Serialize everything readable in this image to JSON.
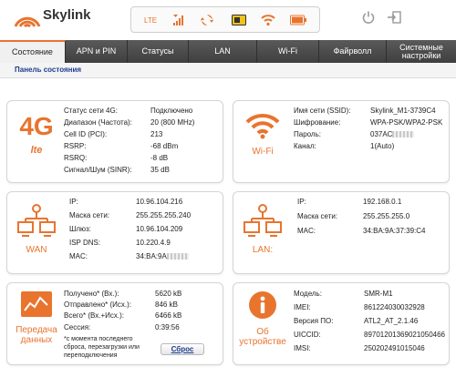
{
  "colors": {
    "accent": "#e8742e",
    "nav_bg": "#4a4a4a",
    "link": "#1d3d8f"
  },
  "header": {
    "brand": "Skylink",
    "status_icons": [
      "lte-text",
      "signal-bars-icon",
      "sync-icon",
      "sim-card-icon",
      "wifi-icon",
      "battery-icon"
    ],
    "lte_label": "LTE"
  },
  "nav": {
    "items": [
      {
        "label": "Состояние"
      },
      {
        "label": "APN и PIN"
      },
      {
        "label": "Статусы"
      },
      {
        "label": "LAN"
      },
      {
        "label": "Wi-Fi"
      },
      {
        "label": "Файрволл"
      },
      {
        "label": "Системные настройки"
      }
    ]
  },
  "subbar": {
    "title": "Панель состояния"
  },
  "panels": {
    "g4": {
      "label_big": "4G",
      "label_small": "lte",
      "rows": [
        {
          "k": "Статус сети 4G:",
          "v": "Подключено"
        },
        {
          "k": "Диапазон (Частота):",
          "v": "20 (800 MHz)"
        },
        {
          "k": "Cell ID (PCI):",
          "v": "213"
        },
        {
          "k": "RSRP:",
          "v": "-68 dBm"
        },
        {
          "k": "RSRQ:",
          "v": "-8 dB"
        },
        {
          "k": "Сигнал/Шум (SINR):",
          "v": "35 dB"
        }
      ]
    },
    "wifi": {
      "label": "Wi-Fi",
      "rows": [
        {
          "k": "Имя сети (SSID):",
          "v": "Skylink_M1-3739C4"
        },
        {
          "k": "Шифрование:",
          "v": "WPA-PSK/WPA2-PSK"
        },
        {
          "k": "Пароль:",
          "v": "037AC"
        },
        {
          "k": "Канал:",
          "v": "1(Auto)"
        }
      ]
    },
    "wan": {
      "label": "WAN",
      "rows": [
        {
          "k": "IP:",
          "v": "10.96.104.216"
        },
        {
          "k": "Маска сети:",
          "v": "255.255.255.240"
        },
        {
          "k": "Шлюз:",
          "v": "10.96.104.209"
        },
        {
          "k": "ISP DNS:",
          "v": "10.220.4.9"
        },
        {
          "k": "MAC:",
          "v": "34:BA:9A"
        }
      ]
    },
    "lan": {
      "label": "LAN:",
      "rows": [
        {
          "k": "IP:",
          "v": "192.168.0.1"
        },
        {
          "k": "Маска сети:",
          "v": "255.255.255.0"
        },
        {
          "k": "MAC:",
          "v": "34:BA:9A:37:39:C4"
        }
      ]
    },
    "data": {
      "label": "Передача данных",
      "rows": [
        {
          "k": "Получено* (Вх.):",
          "v": "5620 kB"
        },
        {
          "k": "Отправлено* (Исх.):",
          "v": "846 kB"
        },
        {
          "k": "Всего* (Вх.+Исх.):",
          "v": "6466 kB"
        },
        {
          "k": "Сессия:",
          "v": "0:39:56"
        }
      ],
      "note": "*с момента последнего сброса, перезагрузки или переподключения",
      "reset_label": "Сброс"
    },
    "device": {
      "label": "Об устройстве",
      "rows": [
        {
          "k": "Модель:",
          "v": "SMR-M1"
        },
        {
          "k": "IMEI:",
          "v": "861224030032928"
        },
        {
          "k": "Версия ПО:",
          "v": "ATL2_AT_2.1.46"
        },
        {
          "k": "UICCID:",
          "v": "89701201369021050466"
        },
        {
          "k": "IMSI:",
          "v": "250202491015046"
        }
      ]
    }
  }
}
